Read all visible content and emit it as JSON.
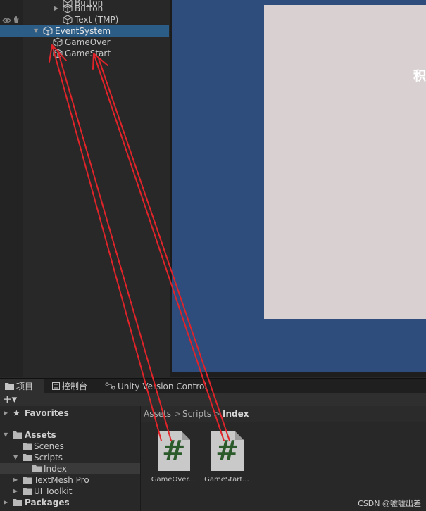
{
  "hierarchy": {
    "items": [
      {
        "label": "Button",
        "foldout": "",
        "selected": false
      },
      {
        "label": "Button",
        "foldout": "right",
        "selected": false
      },
      {
        "label": "Text (TMP)",
        "foldout": "",
        "selected": false
      },
      {
        "label": "EventSystem",
        "foldout": "down",
        "selected": true
      },
      {
        "label": "GameOver",
        "foldout": "",
        "selected": false
      },
      {
        "label": "GameStart",
        "foldout": "",
        "selected": false
      }
    ]
  },
  "scene": {
    "canvas_glyph": "积"
  },
  "tabs": [
    {
      "label": "项目",
      "icon": "folder-icon",
      "active": true
    },
    {
      "label": "控制台",
      "icon": "console-icon",
      "active": false
    },
    {
      "label": "Unity Version Control",
      "icon": "version-control-icon",
      "active": false
    }
  ],
  "toolbar": {
    "add_label": "+▾"
  },
  "project_tree": {
    "favorites": "Favorites",
    "assets": "Assets",
    "scenes": "Scenes",
    "scripts": "Scripts",
    "index": "Index",
    "textmesh_pro": "TextMesh Pro",
    "ui_toolkit": "UI Toolkit",
    "packages": "Packages"
  },
  "breadcrumb": {
    "items": [
      "Assets",
      "Scripts",
      "Index"
    ],
    "separator": ">"
  },
  "assets": [
    {
      "label": "GameOver...",
      "glyph": "#"
    },
    {
      "label": "GameStart...",
      "glyph": "#"
    }
  ],
  "watermark": "CSDN @嘘嘘出差",
  "colors": {
    "selection": "#2c5d87",
    "scene_bg": "#2e4c7c",
    "canvas": "#d9d1d1",
    "script_hash": "#2b5a2b",
    "arrow": "#e0242a"
  }
}
